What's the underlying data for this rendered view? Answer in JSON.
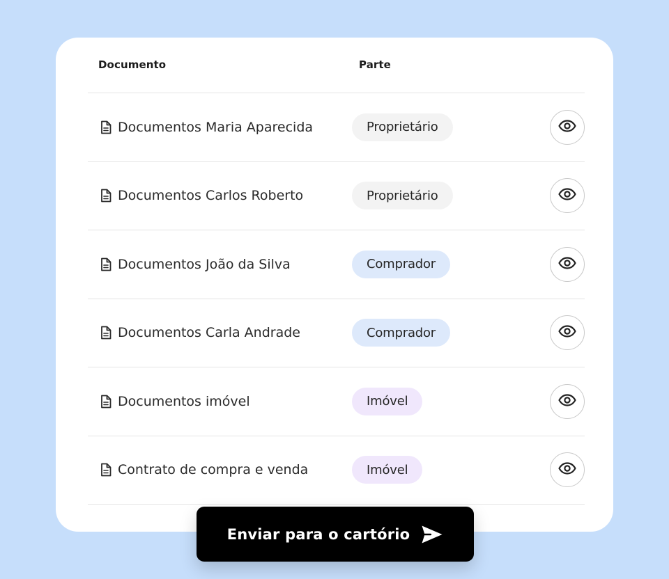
{
  "table": {
    "headers": {
      "document": "Documento",
      "party": "Parte"
    },
    "rows": [
      {
        "document": "Documentos Maria Aparecida",
        "party": "Proprietário",
        "party_type": "owner",
        "doc_icon": "document-icon",
        "action_icon": "eye-icon"
      },
      {
        "document": "Documentos Carlos Roberto",
        "party": "Proprietário",
        "party_type": "owner",
        "doc_icon": "document-icon",
        "action_icon": "eye-icon"
      },
      {
        "document": "Documentos João da Silva",
        "party": "Comprador",
        "party_type": "buyer",
        "doc_icon": "document-icon",
        "action_icon": "eye-icon"
      },
      {
        "document": "Documentos Carla Andrade",
        "party": "Comprador",
        "party_type": "buyer",
        "doc_icon": "document-icon",
        "action_icon": "eye-icon"
      },
      {
        "document": "Documentos imóvel",
        "party": "Imóvel",
        "party_type": "property",
        "doc_icon": "document-icon",
        "action_icon": "eye-icon"
      },
      {
        "document": "Contrato de compra e venda",
        "party": "Imóvel",
        "party_type": "property",
        "doc_icon": "document-icon",
        "action_icon": "eye-icon"
      }
    ]
  },
  "send_button": {
    "label": "Enviar para o cartório",
    "icon": "send-icon"
  },
  "colors": {
    "background": "#c6defb",
    "owner_badge": "#f3f3f3",
    "buyer_badge": "#dde9fb",
    "property_badge": "#f0e7fc",
    "button": "#000000"
  }
}
